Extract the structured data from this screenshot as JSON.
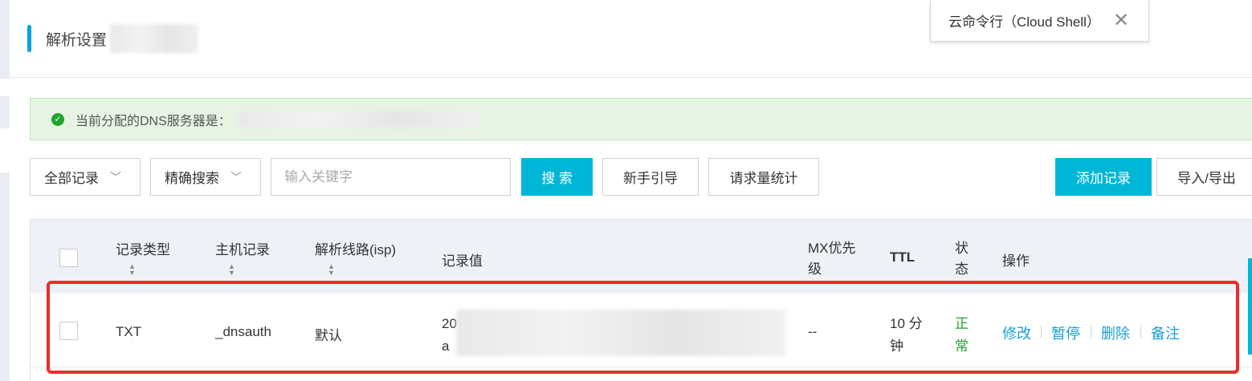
{
  "page": {
    "title": "解析设置"
  },
  "cloud_shell": {
    "label": "云命令行（Cloud Shell）",
    "close_icon": "close-icon"
  },
  "dns_banner": {
    "text": "当前分配的DNS服务器是：",
    "icon": "check-circle-icon"
  },
  "toolbar": {
    "record_filter": "全部记录",
    "search_mode": "精确搜索",
    "search_placeholder": "输入关键字",
    "search_button": "搜 索",
    "guide_button": "新手引导",
    "stats_button": "请求量统计",
    "add_button": "添加记录",
    "import_export_button": "导入/导出"
  },
  "table": {
    "headers": {
      "type": "记录类型",
      "host": "主机记录",
      "line": "解析线路(isp)",
      "value": "记录值",
      "mx_line1": "MX优先",
      "mx_line2": "级",
      "ttl": "TTL",
      "status_line1": "状",
      "status_line2": "态",
      "actions": "操作"
    },
    "rows": [
      {
        "type": "TXT",
        "host": "_dnsauth",
        "line": "默认",
        "value_line1": "20",
        "value_line2": "a",
        "mx": "--",
        "ttl_line1": "10 分",
        "ttl_line2": "钟",
        "status_line1": "正",
        "status_line2": "常",
        "actions": {
          "edit": "修改",
          "pause": "暂停",
          "delete": "删除",
          "note": "备注"
        }
      }
    ]
  },
  "colors": {
    "accent": "#00b6d6",
    "link": "#1a9fd8",
    "success": "#1fa32e",
    "highlight": "#ef2a2a",
    "banner_bg": "#e7f4e4"
  }
}
